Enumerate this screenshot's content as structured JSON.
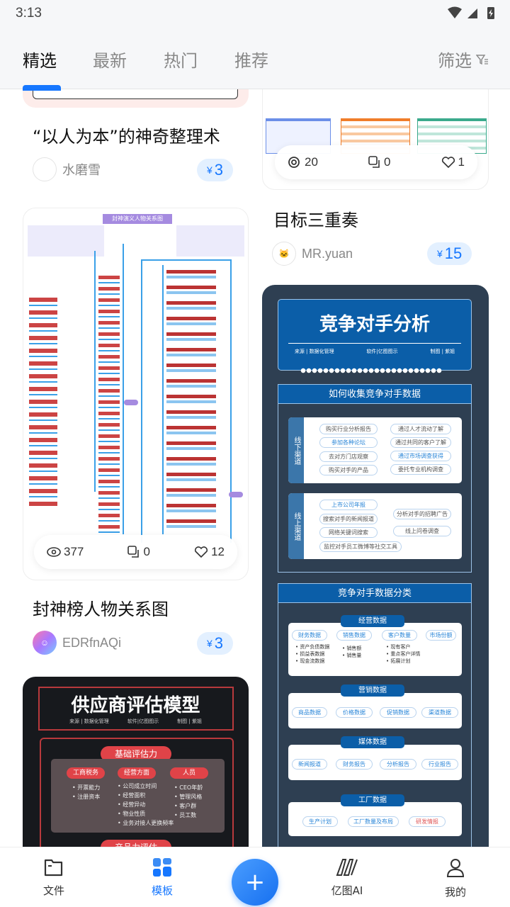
{
  "status_bar": {
    "time": "3:13",
    "icons": [
      "wifi-icon",
      "signal-icon",
      "battery-charging-icon"
    ]
  },
  "tabs": [
    {
      "label": "精选",
      "active": true
    },
    {
      "label": "最新"
    },
    {
      "label": "热门"
    },
    {
      "label": "推荐"
    }
  ],
  "filter": {
    "label": "筛选",
    "icon": "filter-icon"
  },
  "colors": {
    "accent": "#1677ff",
    "price_bg": "#e3f0ff"
  },
  "cards": [
    {
      "title": "“以人为本”的神奇整理术",
      "author": "水磨雪",
      "price": "3",
      "currency": "¥"
    },
    {
      "title": "目标三重奏",
      "author": "MR.yuan",
      "price": "15",
      "currency": "¥",
      "stats": {
        "views": "20",
        "copies": "0",
        "likes": "1"
      }
    },
    {
      "title": "封神榜人物关系图",
      "author": "EDRfnAQi",
      "price": "3",
      "currency": "¥",
      "stats": {
        "views": "377",
        "copies": "0",
        "likes": "12"
      },
      "thumb_title": "封神演义人物关系图"
    },
    {
      "thumb": {
        "title": "供应商评估模型",
        "meta": [
          "来源 | 数据化管理",
          "软件|亿图图示",
          "制图 | 紫姐"
        ],
        "section": "基础评估力",
        "groups": [
          {
            "name": "工商税务",
            "items": [
              "开票能力",
              "注册资本"
            ]
          },
          {
            "name": "经营方面",
            "items": [
              "公司成立时间",
              "经营面积",
              "经营异动",
              "物业性质",
              "业务对接人更换频率"
            ]
          },
          {
            "name": "人员",
            "items": [
              "CEO年龄",
              "管理风格",
              "客户群",
              "员工数"
            ]
          }
        ],
        "next_section": "产品力评估"
      }
    },
    {
      "thumb": {
        "title": "竞争对手分析",
        "meta": [
          "来源 | 数据化管理",
          "软件|亿图图示",
          "制图 | 紫姐"
        ],
        "collect_title": "如何收集竞争对手数据",
        "offline": {
          "label": "线下渠道",
          "left": [
            "购买行业分析报告",
            "参加各种论坛",
            "去对方门店观察",
            "购买对手的产品"
          ],
          "right": [
            "通过人才流动了解",
            "通过共同的客户了解",
            "通过市场调查获得",
            "委托专业机构调查"
          ]
        },
        "online": {
          "label": "线上渠道",
          "left": [
            "上市公司年报",
            "搜索对手的新闻报道",
            "网络关键词搜索",
            "监控对手员工微博等社交工具"
          ],
          "right": [
            "分析对手的招聘广告",
            "线上问卷调查"
          ]
        },
        "class_title": "竞争对手数据分类",
        "categories": [
          {
            "name": "经营数据",
            "items": [
              "财务数据",
              "销售数据",
              "客户数量",
              "市场份额"
            ],
            "subs": [
              [
                "资产负债数据",
                "损益表数据",
                "现金流数据"
              ],
              [
                "销售额",
                "销售量"
              ],
              [
                "现有客户",
                "重点客户详情",
                "拓展计划"
              ]
            ]
          },
          {
            "name": "营销数据",
            "items": [
              "商品数据",
              "价格数据",
              "促销数据",
              "渠道数据"
            ]
          },
          {
            "name": "媒体数据",
            "items": [
              "新闻报道",
              "财务报告",
              "分析报告",
              "行业报告"
            ]
          },
          {
            "name": "工厂数据",
            "items": [
              "生产计划",
              "工厂数量及布局",
              "研发情报"
            ]
          }
        ]
      }
    }
  ],
  "bottom_nav": [
    {
      "label": "文件",
      "icon": "folder-icon"
    },
    {
      "label": "模板",
      "icon": "template-grid-icon",
      "active": true
    },
    {
      "label": "",
      "icon": "plus-icon"
    },
    {
      "label": "亿图AI",
      "icon": "edraw-ai-icon"
    },
    {
      "label": "我的",
      "icon": "user-icon"
    }
  ]
}
